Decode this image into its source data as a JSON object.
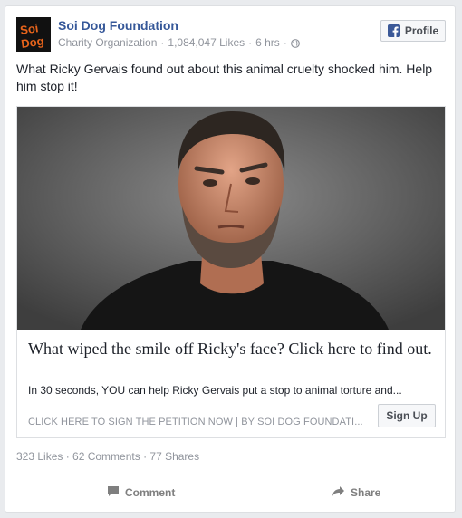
{
  "post": {
    "page_name": "Soi Dog Foundation",
    "category": "Charity Organization",
    "likes_count": "1,084,047 Likes",
    "time": "6 hrs",
    "separator": "·",
    "profile_button": "Profile",
    "logo_text_line1": "Soi",
    "logo_text_line2": "Dog",
    "text": "What Ricky Gervais found out about this animal cruelty shocked him. Help him stop it!"
  },
  "link": {
    "headline": "What wiped the smile off Ricky's face? Click here to find out.",
    "description": "In 30 seconds, YOU can help Ricky Gervais put a stop to animal torture and...",
    "caption": "CLICK HERE TO SIGN THE PETITION NOW  |  BY SOI DOG FOUNDATI...",
    "cta_button": "Sign Up"
  },
  "stats": {
    "summary": "323 Likes · 62 Comments · 77 Shares"
  },
  "actions": {
    "comment_label": "Comment",
    "share_label": "Share"
  },
  "colors": {
    "link_blue": "#365899",
    "facebook_blue": "#3b5998",
    "logo_orange": "#e8641b",
    "muted_text": "#90949c"
  }
}
